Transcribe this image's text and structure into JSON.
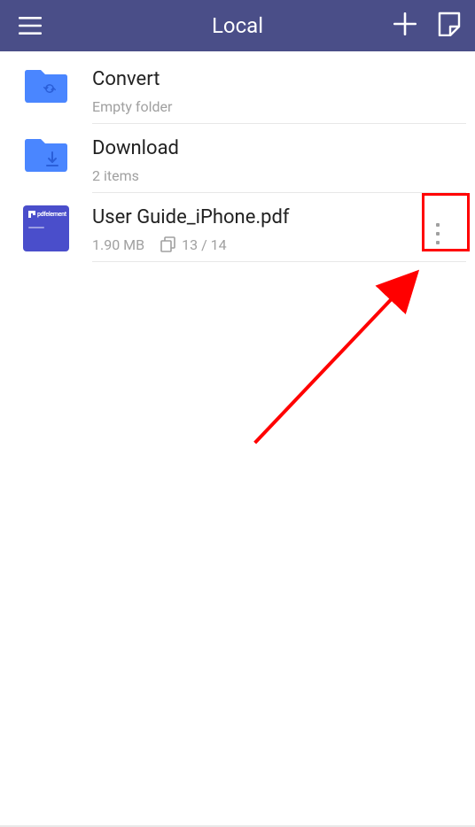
{
  "header": {
    "title": "Local"
  },
  "items": [
    {
      "kind": "folder",
      "name": "Convert",
      "subtitle": "Empty folder",
      "overlay": "sync"
    },
    {
      "kind": "folder",
      "name": "Download",
      "subtitle": "2 items",
      "overlay": "download"
    },
    {
      "kind": "file",
      "name": "User Guide_iPhone.pdf",
      "size": "1.90 MB",
      "pages": "13 / 14",
      "thumb_label": "pdfelement"
    }
  ]
}
